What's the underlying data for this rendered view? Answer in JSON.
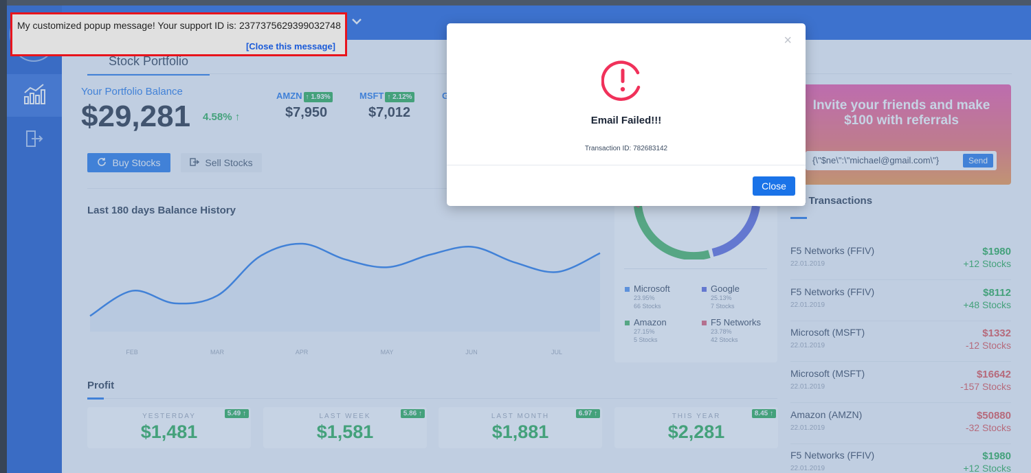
{
  "popup": {
    "message": "My customized popup message! Your support ID is: 2377375629399032748",
    "close_link": "[Close this message]"
  },
  "main": {
    "tab_title": "Stock Portfolio",
    "balance_label": "Your Portfolio Balance",
    "balance_value": "$29,281",
    "balance_change": "4.58% ↑",
    "tickers": [
      {
        "symbol": "AMZN",
        "change": "↑ 1.93%",
        "price": "$7,950"
      },
      {
        "symbol": "MSFT",
        "change": "↑ 2.12%",
        "price": "$7,012"
      },
      {
        "symbol": "G",
        "change": "",
        "price": ""
      }
    ],
    "buy_label": "Buy Stocks",
    "sell_label": "Sell Stocks",
    "history_title": "Last 180 days Balance History",
    "profit_title": "Profit"
  },
  "chart_data": {
    "type": "line",
    "title": "Last 180 days Balance History",
    "x": [
      "FEB",
      "MAR",
      "APR",
      "MAY",
      "JUN",
      "JUL"
    ],
    "tick_labels": [
      "FEB",
      "MAR",
      "APR",
      "MAY",
      "JUN",
      "JUL"
    ],
    "series": [
      {
        "values": [
          1.0,
          2.6,
          1.8,
          2.3,
          4.8,
          5.6,
          4.6,
          4.1,
          4.9,
          5.4,
          4.4,
          3.8,
          5.0
        ]
      }
    ],
    "ylim": [
      0,
      7
    ],
    "grid": false
  },
  "donut": {
    "legend": [
      {
        "name": "Microsoft",
        "pct": "23.95%",
        "stocks": "66 Stocks",
        "color": "#4a8df0"
      },
      {
        "name": "Google",
        "pct": "25.13%",
        "stocks": "7 Stocks",
        "color": "#5663dc"
      },
      {
        "name": "Amazon",
        "pct": "27.15%",
        "stocks": "5 Stocks",
        "color": "#3fb15a"
      },
      {
        "name": "F5 Networks",
        "pct": "23.78%",
        "stocks": "42 Stocks",
        "color": "#e0566d"
      }
    ]
  },
  "profit": [
    {
      "label": "YESTERDAY",
      "value": "$1,481",
      "badge": "5.49 ↑"
    },
    {
      "label": "LAST WEEK",
      "value": "$1,581",
      "badge": "5.86 ↑"
    },
    {
      "label": "LAST MONTH",
      "value": "$1,881",
      "badge": "6.97 ↑"
    },
    {
      "label": "THIS YEAR",
      "value": "$2,281",
      "badge": "8.45 ↑"
    }
  ],
  "referral": {
    "title_line1": "Invite your friends and make",
    "title_line2": "$100 with referrals",
    "input_value": "{\\\"$ne\\\":\\\"michael@gmail.com\\\"}",
    "send_label": "Send"
  },
  "transactions": {
    "title": "st Transactions",
    "rows": [
      {
        "name": "F5 Networks (FFIV)",
        "date": "22.01.2019",
        "amount": "$1980",
        "qty": "+12 Stocks",
        "sign": "pos"
      },
      {
        "name": "F5 Networks (FFIV)",
        "date": "22.01.2019",
        "amount": "$8112",
        "qty": "+48 Stocks",
        "sign": "pos"
      },
      {
        "name": "Microsoft (MSFT)",
        "date": "22.01.2019",
        "amount": "$1332",
        "qty": "-12 Stocks",
        "sign": "neg"
      },
      {
        "name": "Microsoft (MSFT)",
        "date": "22.01.2019",
        "amount": "$16642",
        "qty": "-157 Stocks",
        "sign": "neg"
      },
      {
        "name": "Amazon (AMZN)",
        "date": "22.01.2019",
        "amount": "$50880",
        "qty": "-32 Stocks",
        "sign": "neg"
      },
      {
        "name": "F5 Networks (FFIV)",
        "date": "22.01.2019",
        "amount": "$1980",
        "qty": "+12 Stocks",
        "sign": "pos"
      }
    ]
  },
  "modal": {
    "close_x": "×",
    "title": "Email Failed!!!",
    "transaction_id": "Transaction ID: 782683142",
    "close_label": "Close"
  },
  "colors": {
    "accent": "#1a73e8",
    "positive": "#1faa4b",
    "negative": "#e34b4b",
    "alert": "#f0315a"
  }
}
